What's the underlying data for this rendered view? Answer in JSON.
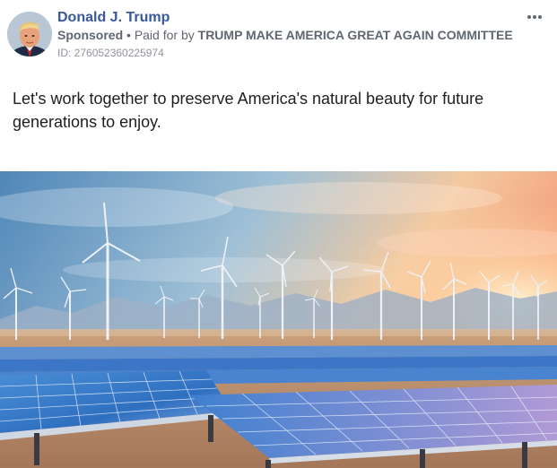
{
  "post": {
    "author": "Donald J. Trump",
    "sponsored_label": "Sponsored",
    "separator": "•",
    "paid_for_prefix": "Paid for by",
    "paid_for_by": "TRUMP MAKE AMERICA GREAT AGAIN COMMITTEE",
    "ad_id": "ID: 276052360225974",
    "message": "Let's work together to preserve America's natural beauty for future generations to enjoy."
  },
  "icons": {
    "more": "more-options-icon",
    "avatar": "profile-photo"
  },
  "colors": {
    "author_link": "#385898",
    "meta_text": "#606770",
    "id_text": "#90949c",
    "body_text": "#1c1e21"
  }
}
